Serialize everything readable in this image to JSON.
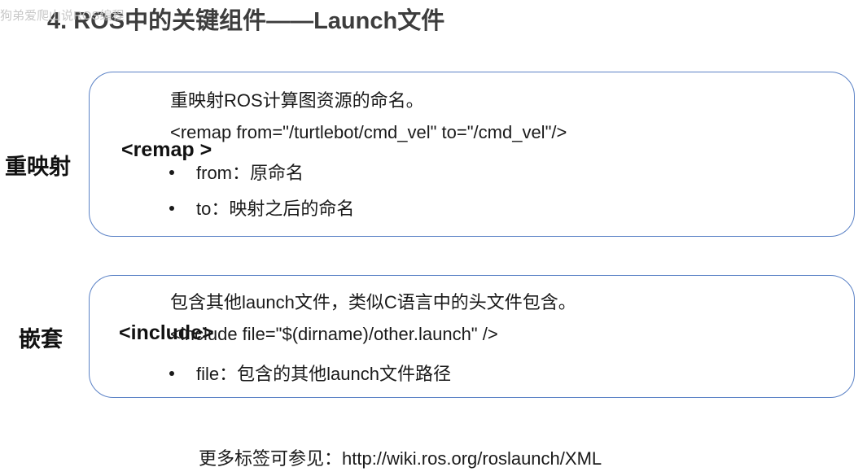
{
  "watermark": "狗弟爱爬山说ROS编程",
  "title": "4. ROS中的关键组件——Launch文件",
  "sections": [
    {
      "label": "重映射",
      "tag": "<remap >",
      "description": "重映射ROS计算图资源的命名。",
      "example": "<remap from=\"/turtlebot/cmd_vel\" to=\"/cmd_vel\"/>",
      "bullets": [
        "from：原命名",
        "to：映射之后的命名"
      ]
    },
    {
      "label": "嵌套",
      "tag": "<include>",
      "description": "包含其他launch文件，类似C语言中的头文件包含。",
      "example": "<include file=\"$(dirname)/other.launch\" />",
      "bullets": [
        "file：包含的其他launch文件路径"
      ]
    }
  ],
  "footer": "更多标签可参见：http://wiki.ros.org/roslaunch/XML"
}
